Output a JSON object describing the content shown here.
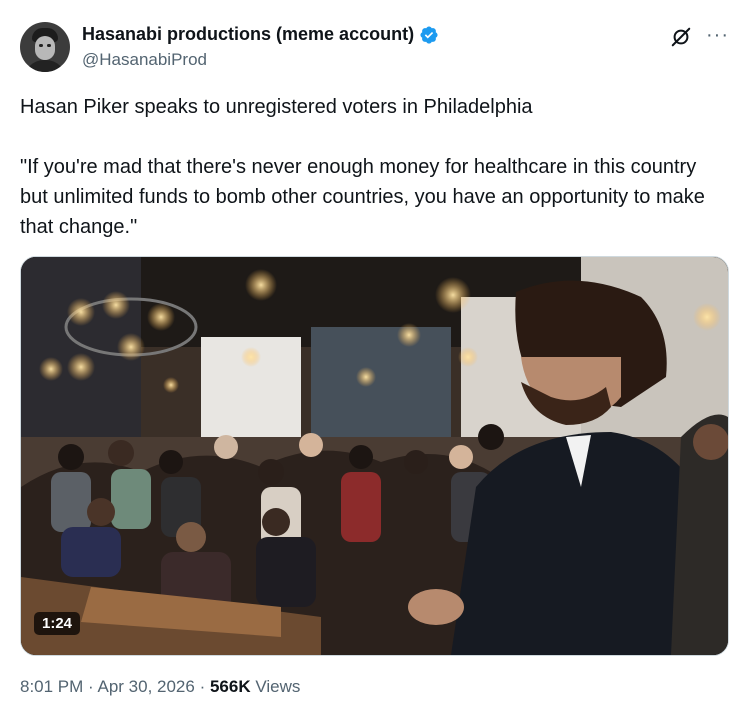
{
  "author": {
    "name": "Hasanabi productions (meme account)",
    "handle": "@HasanabiProd",
    "verified": true,
    "verified_color": "#1d9bf0"
  },
  "icons": {
    "grok": "grok-icon",
    "more": "more-options-icon"
  },
  "tweet": {
    "line1": "Hasan Piker speaks to unregistered voters in Philadelphia",
    "quote": "\"If you're mad that there's never enough money for healthcare in this country but unlimited funds to bomb other countries, you have an opportunity to make that change.\""
  },
  "media": {
    "duration": "1:24"
  },
  "meta": {
    "time": "8:01 PM",
    "sep1": " · ",
    "date": "Apr 30, 2026",
    "sep2": " · ",
    "views_count": "566K",
    "views_label": " Views"
  }
}
